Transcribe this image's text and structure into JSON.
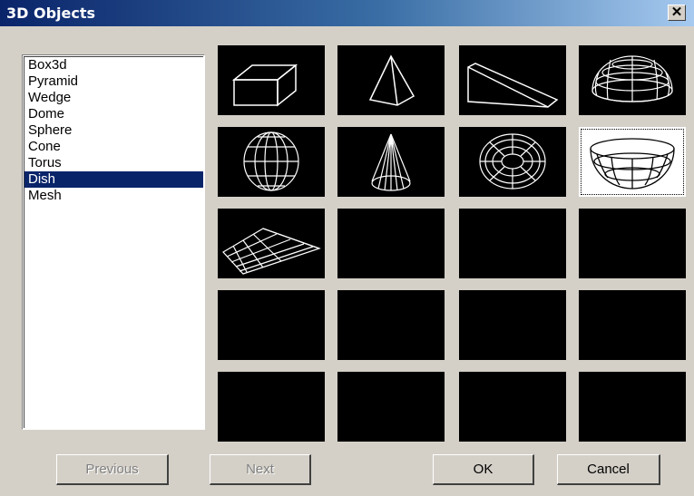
{
  "window": {
    "title": "3D Objects",
    "close_glyph": "✕"
  },
  "objects": [
    "Box3d",
    "Pyramid",
    "Wedge",
    "Dome",
    "Sphere",
    "Cone",
    "Torus",
    "Dish",
    "Mesh"
  ],
  "selected_index": 7,
  "buttons": {
    "previous": "Previous",
    "next": "Next",
    "ok": "OK",
    "cancel": "Cancel"
  }
}
